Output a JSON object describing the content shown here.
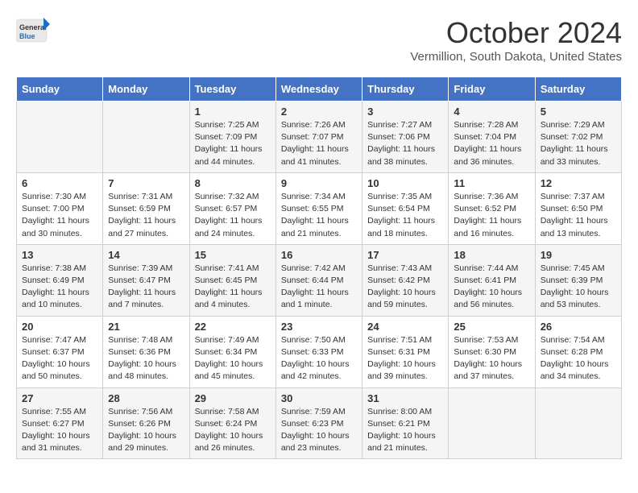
{
  "header": {
    "logo_general": "General",
    "logo_blue": "Blue",
    "month_title": "October 2024",
    "subtitle": "Vermillion, South Dakota, United States"
  },
  "weekdays": [
    "Sunday",
    "Monday",
    "Tuesday",
    "Wednesday",
    "Thursday",
    "Friday",
    "Saturday"
  ],
  "weeks": [
    [
      {
        "day": "",
        "info": ""
      },
      {
        "day": "",
        "info": ""
      },
      {
        "day": "1",
        "info": "Sunrise: 7:25 AM\nSunset: 7:09 PM\nDaylight: 11 hours and 44 minutes."
      },
      {
        "day": "2",
        "info": "Sunrise: 7:26 AM\nSunset: 7:07 PM\nDaylight: 11 hours and 41 minutes."
      },
      {
        "day": "3",
        "info": "Sunrise: 7:27 AM\nSunset: 7:06 PM\nDaylight: 11 hours and 38 minutes."
      },
      {
        "day": "4",
        "info": "Sunrise: 7:28 AM\nSunset: 7:04 PM\nDaylight: 11 hours and 36 minutes."
      },
      {
        "day": "5",
        "info": "Sunrise: 7:29 AM\nSunset: 7:02 PM\nDaylight: 11 hours and 33 minutes."
      }
    ],
    [
      {
        "day": "6",
        "info": "Sunrise: 7:30 AM\nSunset: 7:00 PM\nDaylight: 11 hours and 30 minutes."
      },
      {
        "day": "7",
        "info": "Sunrise: 7:31 AM\nSunset: 6:59 PM\nDaylight: 11 hours and 27 minutes."
      },
      {
        "day": "8",
        "info": "Sunrise: 7:32 AM\nSunset: 6:57 PM\nDaylight: 11 hours and 24 minutes."
      },
      {
        "day": "9",
        "info": "Sunrise: 7:34 AM\nSunset: 6:55 PM\nDaylight: 11 hours and 21 minutes."
      },
      {
        "day": "10",
        "info": "Sunrise: 7:35 AM\nSunset: 6:54 PM\nDaylight: 11 hours and 18 minutes."
      },
      {
        "day": "11",
        "info": "Sunrise: 7:36 AM\nSunset: 6:52 PM\nDaylight: 11 hours and 16 minutes."
      },
      {
        "day": "12",
        "info": "Sunrise: 7:37 AM\nSunset: 6:50 PM\nDaylight: 11 hours and 13 minutes."
      }
    ],
    [
      {
        "day": "13",
        "info": "Sunrise: 7:38 AM\nSunset: 6:49 PM\nDaylight: 11 hours and 10 minutes."
      },
      {
        "day": "14",
        "info": "Sunrise: 7:39 AM\nSunset: 6:47 PM\nDaylight: 11 hours and 7 minutes."
      },
      {
        "day": "15",
        "info": "Sunrise: 7:41 AM\nSunset: 6:45 PM\nDaylight: 11 hours and 4 minutes."
      },
      {
        "day": "16",
        "info": "Sunrise: 7:42 AM\nSunset: 6:44 PM\nDaylight: 11 hours and 1 minute."
      },
      {
        "day": "17",
        "info": "Sunrise: 7:43 AM\nSunset: 6:42 PM\nDaylight: 10 hours and 59 minutes."
      },
      {
        "day": "18",
        "info": "Sunrise: 7:44 AM\nSunset: 6:41 PM\nDaylight: 10 hours and 56 minutes."
      },
      {
        "day": "19",
        "info": "Sunrise: 7:45 AM\nSunset: 6:39 PM\nDaylight: 10 hours and 53 minutes."
      }
    ],
    [
      {
        "day": "20",
        "info": "Sunrise: 7:47 AM\nSunset: 6:37 PM\nDaylight: 10 hours and 50 minutes."
      },
      {
        "day": "21",
        "info": "Sunrise: 7:48 AM\nSunset: 6:36 PM\nDaylight: 10 hours and 48 minutes."
      },
      {
        "day": "22",
        "info": "Sunrise: 7:49 AM\nSunset: 6:34 PM\nDaylight: 10 hours and 45 minutes."
      },
      {
        "day": "23",
        "info": "Sunrise: 7:50 AM\nSunset: 6:33 PM\nDaylight: 10 hours and 42 minutes."
      },
      {
        "day": "24",
        "info": "Sunrise: 7:51 AM\nSunset: 6:31 PM\nDaylight: 10 hours and 39 minutes."
      },
      {
        "day": "25",
        "info": "Sunrise: 7:53 AM\nSunset: 6:30 PM\nDaylight: 10 hours and 37 minutes."
      },
      {
        "day": "26",
        "info": "Sunrise: 7:54 AM\nSunset: 6:28 PM\nDaylight: 10 hours and 34 minutes."
      }
    ],
    [
      {
        "day": "27",
        "info": "Sunrise: 7:55 AM\nSunset: 6:27 PM\nDaylight: 10 hours and 31 minutes."
      },
      {
        "day": "28",
        "info": "Sunrise: 7:56 AM\nSunset: 6:26 PM\nDaylight: 10 hours and 29 minutes."
      },
      {
        "day": "29",
        "info": "Sunrise: 7:58 AM\nSunset: 6:24 PM\nDaylight: 10 hours and 26 minutes."
      },
      {
        "day": "30",
        "info": "Sunrise: 7:59 AM\nSunset: 6:23 PM\nDaylight: 10 hours and 23 minutes."
      },
      {
        "day": "31",
        "info": "Sunrise: 8:00 AM\nSunset: 6:21 PM\nDaylight: 10 hours and 21 minutes."
      },
      {
        "day": "",
        "info": ""
      },
      {
        "day": "",
        "info": ""
      }
    ]
  ]
}
